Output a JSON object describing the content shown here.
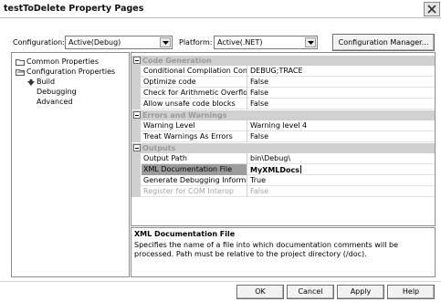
{
  "window": {
    "title": "testToDelete Property Pages"
  },
  "config": {
    "configuration_label": "Configuration:",
    "configuration_value": "Active(Debug)",
    "platform_label": "Platform:",
    "platform_value": "Active(.NET)",
    "manager_button": "Configuration Manager..."
  },
  "tree": {
    "common": "Common Properties",
    "config": "Configuration Properties",
    "build": "Build",
    "debugging": "Debugging",
    "advanced": "Advanced"
  },
  "grid": {
    "categories": [
      "Code Generation",
      "Errors and Warnings",
      "Outputs"
    ],
    "code_generation": [
      {
        "name": "Conditional Compilation Constan",
        "value": "DEBUG;TRACE"
      },
      {
        "name": "Optimize code",
        "value": "False"
      },
      {
        "name": "Check for Arithmetic Overflow/L",
        "value": "False"
      },
      {
        "name": "Allow unsafe code blocks",
        "value": "False"
      }
    ],
    "errors_and_warnings": [
      {
        "name": "Warning Level",
        "value": "Warning level 4"
      },
      {
        "name": "Treat Warnings As Errors",
        "value": "False"
      }
    ],
    "outputs": [
      {
        "name": "Output Path",
        "value": "bin\\Debug\\"
      },
      {
        "name": "XML Documentation File",
        "value": "MyXMLDocs"
      },
      {
        "name": "Generate Debugging Informatio",
        "value": "True"
      },
      {
        "name": "Register for COM Interop",
        "value": "False"
      }
    ]
  },
  "description": {
    "title": "XML Documentation File",
    "text": "Specifies the name of a file into which documentation comments will be processed. Path must be relative to the project directory (/doc)."
  },
  "buttons": {
    "ok": "OK",
    "cancel": "Cancel",
    "apply": "Apply",
    "help": "Help"
  },
  "icons": {
    "close": "close-icon",
    "dropdown": "chevron-down-icon",
    "folder": "folder-icon",
    "build": "build-arrow-icon"
  }
}
